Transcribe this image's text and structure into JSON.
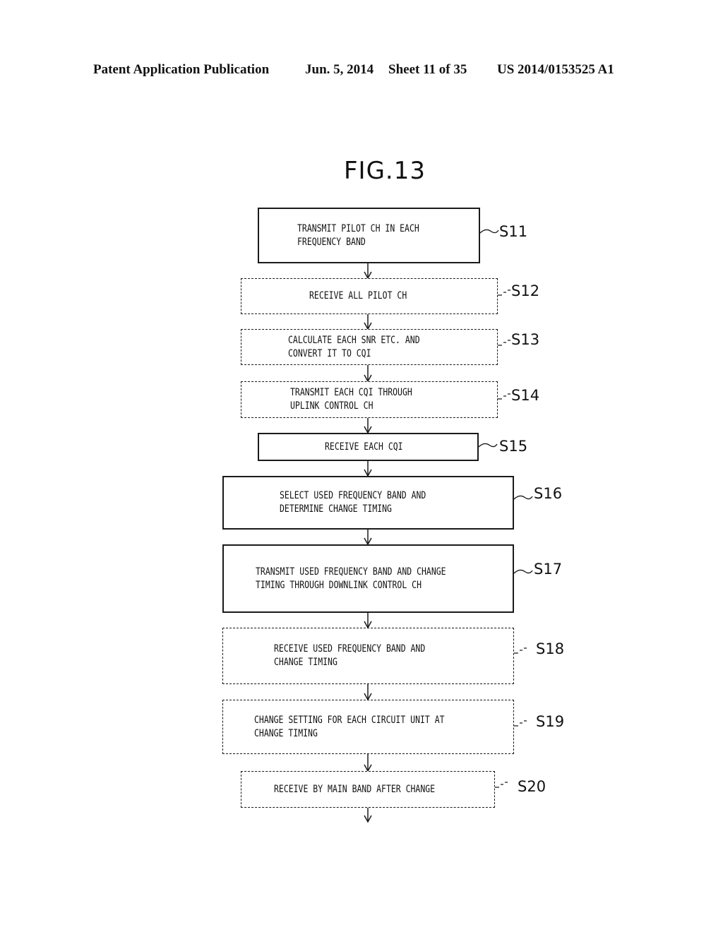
{
  "header": {
    "publication": "Patent Application Publication",
    "date": "Jun. 5, 2014",
    "sheet": "Sheet 11 of 35",
    "number": "US 2014/0153525 A1"
  },
  "figure": {
    "title": "FIG.13"
  },
  "steps": [
    {
      "id": "S11",
      "label": "S11",
      "style": "solid",
      "text": "TRANSMIT PILOT CH IN EACH\nFREQUENCY BAND"
    },
    {
      "id": "S12",
      "label": "S12",
      "style": "dashed",
      "text": "RECEIVE ALL PILOT CH"
    },
    {
      "id": "S13",
      "label": "S13",
      "style": "dashed",
      "text": "CALCULATE EACH SNR ETC. AND\nCONVERT IT TO CQI"
    },
    {
      "id": "S14",
      "label": "S14",
      "style": "dashed",
      "text": "TRANSMIT EACH CQI THROUGH\nUPLINK CONTROL CH"
    },
    {
      "id": "S15",
      "label": "S15",
      "style": "solid",
      "text": "RECEIVE EACH CQI"
    },
    {
      "id": "S16",
      "label": "S16",
      "style": "solid",
      "text": "SELECT USED FREQUENCY BAND AND\nDETERMINE CHANGE TIMING"
    },
    {
      "id": "S17",
      "label": "S17",
      "style": "solid",
      "text": "TRANSMIT USED FREQUENCY BAND AND CHANGE\nTIMING THROUGH DOWNLINK CONTROL CH"
    },
    {
      "id": "S18",
      "label": "S18",
      "style": "dashed",
      "text": "RECEIVE USED FREQUENCY BAND AND\nCHANGE TIMING"
    },
    {
      "id": "S19",
      "label": "S19",
      "style": "dashed",
      "text": "CHANGE SETTING FOR EACH CIRCUIT UNIT AT\nCHANGE TIMING"
    },
    {
      "id": "S20",
      "label": "S20",
      "style": "dashed",
      "text": "RECEIVE BY MAIN BAND AFTER CHANGE"
    }
  ]
}
